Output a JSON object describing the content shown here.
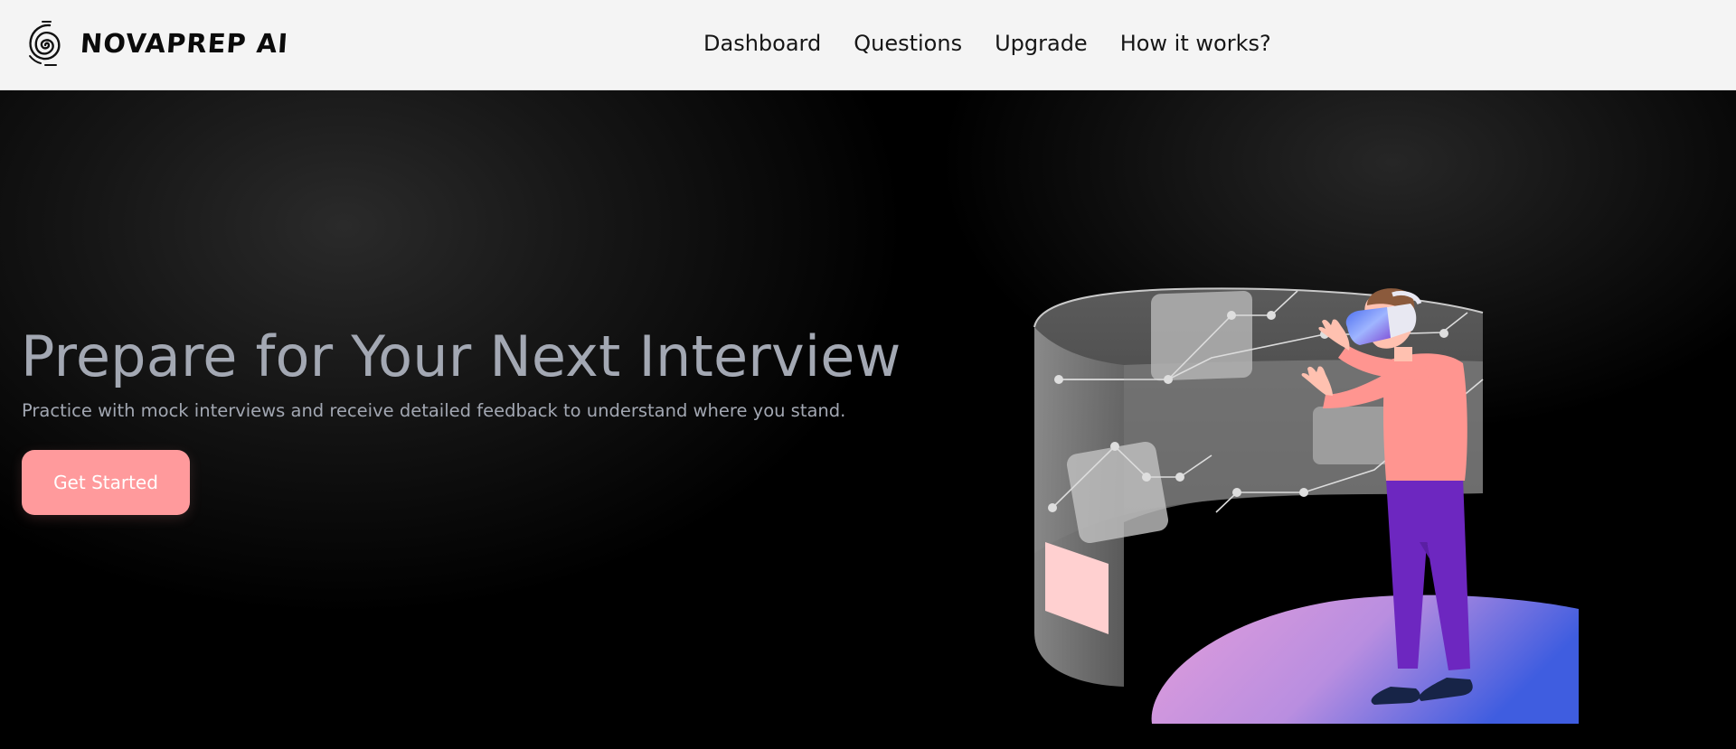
{
  "header": {
    "brand_name": "NOVAPREP AI",
    "brand_icon": "spiral-logo-icon",
    "nav": [
      "Dashboard",
      "Questions",
      "Upgrade",
      "How it works?"
    ]
  },
  "hero": {
    "headline": "Prepare for Your Next Interview",
    "subhead": "Practice with mock interviews and receive detailed feedback to understand where you stand.",
    "cta_label": "Get Started",
    "illustration": "person-with-vr-headset-illustration"
  },
  "colors": {
    "header_bg": "#f4f4f4",
    "hero_bg": "#000000",
    "headline": "#a3a8b3",
    "cta": "#ff9a9c",
    "platform_start": "#e6a0da",
    "platform_end": "#3f5ee0",
    "pants": "#6d27c0",
    "shirt": "#ff9590"
  }
}
